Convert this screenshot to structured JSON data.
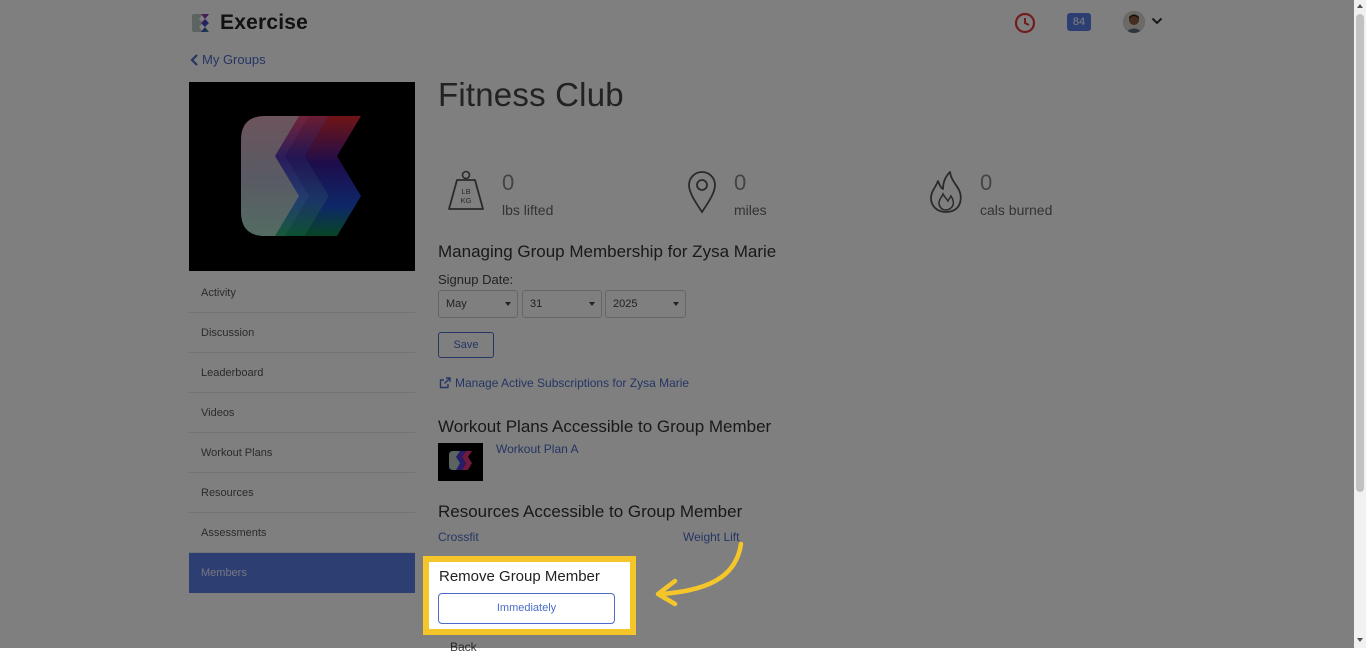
{
  "app": {
    "name": "Exercise"
  },
  "header": {
    "badge_count": "84",
    "icons": [
      "clock-icon",
      "chevron-down-icon"
    ]
  },
  "nav": {
    "back_label": "My Groups"
  },
  "group": {
    "title": "Fitness Club"
  },
  "sidebar": {
    "items": [
      {
        "label": "Activity"
      },
      {
        "label": "Discussion"
      },
      {
        "label": "Leaderboard"
      },
      {
        "label": "Videos"
      },
      {
        "label": "Workout Plans"
      },
      {
        "label": "Resources"
      },
      {
        "label": "Assessments"
      },
      {
        "label": "Members"
      }
    ],
    "active_item": "Members"
  },
  "stats": [
    {
      "icon": "weight-icon",
      "value": "0",
      "label": "lbs lifted",
      "icon_text_top": "LB",
      "icon_text_bottom": "KG"
    },
    {
      "icon": "map-pin-icon",
      "value": "0",
      "label": "miles"
    },
    {
      "icon": "flame-icon",
      "value": "0",
      "label": "cals burned"
    }
  ],
  "membership": {
    "heading": "Managing Group Membership for Zysa Marie",
    "signup_label": "Signup Date:",
    "month": "May",
    "day": "31",
    "year": "2025",
    "save_label": "Save",
    "subscriptions_link": "Manage Active Subscriptions for Zysa Marie"
  },
  "workout_plans": {
    "heading": "Workout Plans Accessible to Group Member",
    "items": [
      {
        "label": "Workout Plan A"
      }
    ]
  },
  "resources": {
    "heading": "Resources Accessible to Group Member",
    "items": [
      {
        "label": "Crossfit"
      },
      {
        "label": "Weight Lift"
      }
    ]
  },
  "remove": {
    "heading": "Remove Group Member",
    "button_label": "Immediately"
  },
  "bottom": {
    "partial_text": "Back"
  },
  "colors": {
    "accent": "#5b7ce5",
    "link": "#4b6cc8",
    "highlight": "#f5c62a",
    "clock": "#e03b3b"
  }
}
